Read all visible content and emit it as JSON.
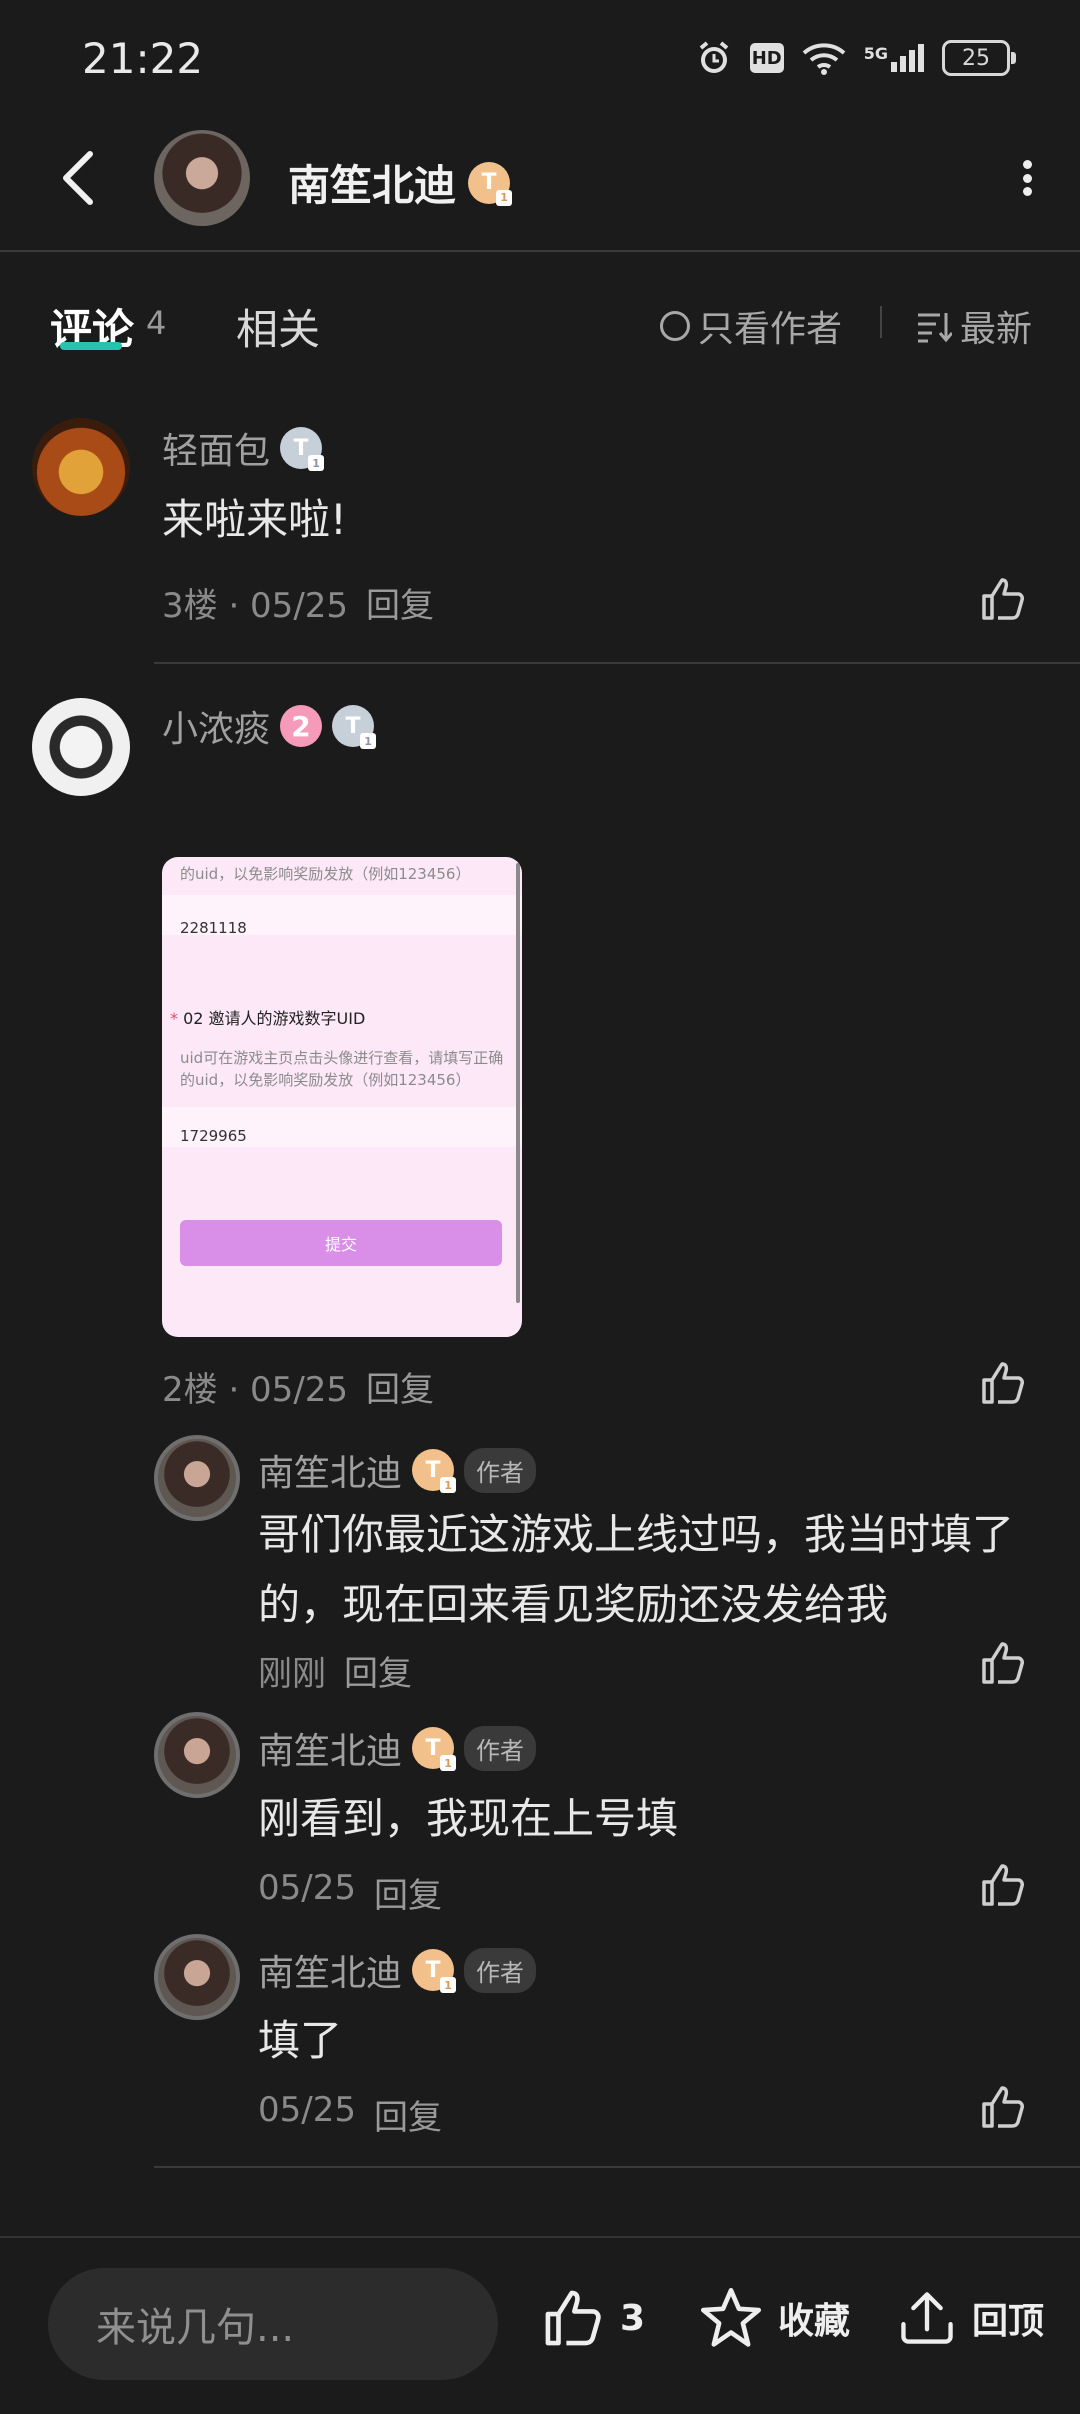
{
  "status": {
    "time": "21:22",
    "hd": "HD",
    "network": "5G",
    "battery": "25"
  },
  "header": {
    "title": "南笙北迪"
  },
  "tabs": {
    "comments_label": "评论",
    "comments_count": "4",
    "related_label": "相关",
    "author_only_label": "只看作者",
    "sort_label": "最新"
  },
  "comments": [
    {
      "username": "轻面包",
      "text": "来啦来啦!",
      "floor": "3楼 · 05/25",
      "reply": "回复"
    },
    {
      "username": "小浓痰",
      "level": "2",
      "floor": "2楼 · 05/25",
      "reply": "回复",
      "image": {
        "line1": "的uid，以免影响奖励发放（例如123456）",
        "value1": "2281118",
        "star": "*",
        "title": "02 邀请人的游戏数字UID",
        "desc1": "uid可在游戏主页点击头像进行查看，请填写正确",
        "desc2": "的uid，以免影响奖励发放（例如123456）",
        "value2": "1729965",
        "button": "提交"
      }
    }
  ],
  "replies": [
    {
      "username": "南笙北迪",
      "tag": "作者",
      "text1": "哥们你最近这游戏上线过吗，我当时填了",
      "text2": "的，现在回来看见奖励还没发给我",
      "time": "刚刚",
      "reply": "回复"
    },
    {
      "username": "南笙北迪",
      "tag": "作者",
      "text1": "刚看到，我现在上号填",
      "time": "05/25",
      "reply": "回复"
    },
    {
      "username": "南笙北迪",
      "tag": "作者",
      "text1": "填了",
      "time": "05/25",
      "reply": "回复"
    }
  ],
  "bottom": {
    "input_placeholder": "来说几句...",
    "like_count": "3",
    "collect_label": "收藏",
    "top_label": "回顶"
  },
  "colors": {
    "background": "#1b1b1b",
    "accent": "#27c3b0",
    "button": "#d98ee8"
  }
}
